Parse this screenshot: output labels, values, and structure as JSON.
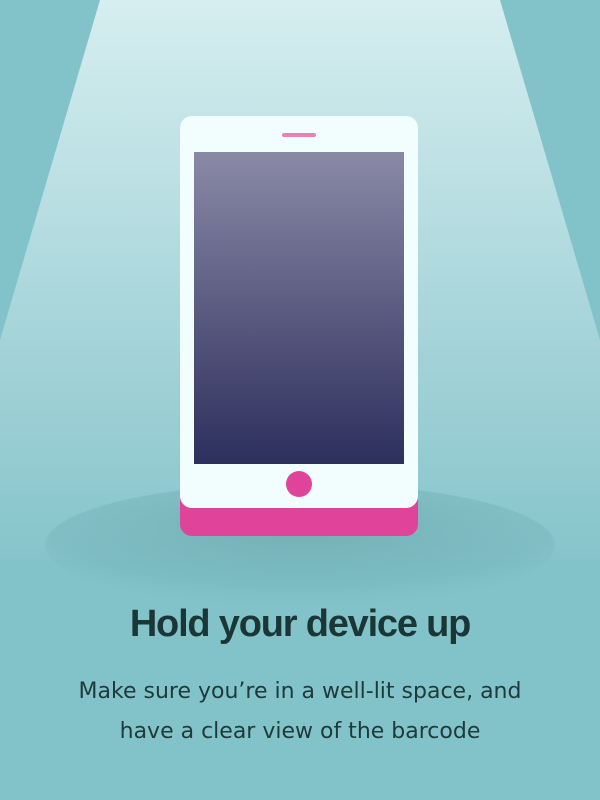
{
  "onboarding": {
    "title": "Hold your device up",
    "description_lines": [
      "Make sure you’re in a well-lit space, and",
      "have a clear view of the barcode"
    ]
  },
  "colors": {
    "background": "#82c3ca",
    "spotlight": "#d6eef0",
    "device_body": "#f2fdfd",
    "device_accent": "#e0449a",
    "screen_top": "#8a89a6",
    "screen_bottom": "#2d2f5d",
    "title_text": "#1a3636",
    "body_text": "#1e3a3a"
  },
  "icons": {
    "illustration": "smartphone-icon"
  }
}
